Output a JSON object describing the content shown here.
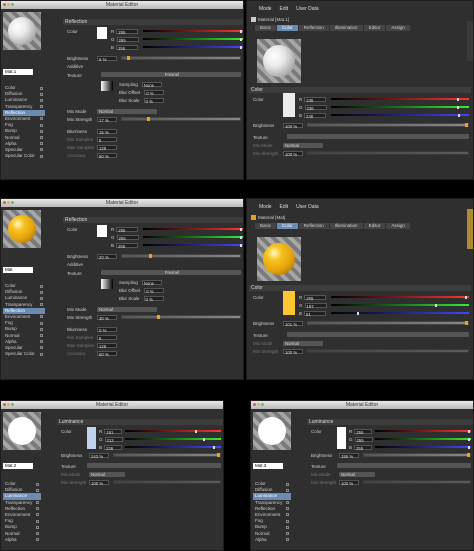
{
  "editor": {
    "title": "Material Editor",
    "mat1": "Mat.1",
    "mat": "Mat",
    "mat2": "Mat.2",
    "mat3": "Mat.3"
  },
  "channels_a": [
    "Color",
    "Diffusion",
    "Luminance",
    "Transparency",
    "Reflection",
    "Environment",
    "Fog",
    "Bump",
    "Normal",
    "Alpha",
    "Specular",
    "Specular Color"
  ],
  "channels_b": [
    "Color",
    "Diffusion",
    "Luminance",
    "Transparency",
    "Reflection",
    "Environment",
    "Fog",
    "Bump",
    "Normal",
    "Alpha",
    "Specular",
    "Specular Color"
  ],
  "channels_c": [
    "Color",
    "Diffusion",
    "Luminance",
    "Transparency",
    "Reflection",
    "Environment",
    "Fog",
    "Bump",
    "Normal",
    "Alpha"
  ],
  "reflection": {
    "header": "Reflection",
    "color": "Color",
    "r": "R",
    "g": "G",
    "b": "B",
    "v255": "255",
    "brightness_label": "Brightness",
    "brightness1": "6 %",
    "brightness2": "20 %",
    "additive": "Additive",
    "texture": "Texture",
    "fresnel": "Fresnel",
    "sampling": "Sampling",
    "sampling_val": "None",
    "blur_offset": "Blur Offset",
    "blur_scale": "Blur Scale",
    "zero": "0 %",
    "mix_mode": "Mix Mode",
    "normal": "Normal",
    "mix_strength": "Mix Strength",
    "ms1": "17 %",
    "ms2": "30 %",
    "blurriness": "Blurriness",
    "bl1": "15 %",
    "bl2": "0 %",
    "min_samples": "Min Samples",
    "min_val": "5",
    "max_samples": "Max Samples",
    "max_val": "128",
    "accuracy": "Accuracy",
    "acc_val": "50 %"
  },
  "attr": {
    "menu": [
      "Mode",
      "Edit",
      "User Data"
    ],
    "mat1": "Material [Mat.1]",
    "mat": "Material [Mat]",
    "tabs": [
      "Basic",
      "Color",
      "Reflection",
      "Illumination",
      "Editor",
      "Assign"
    ],
    "color_head": "Color",
    "color": "Color",
    "r": "R",
    "g": "G",
    "b": "B",
    "w1": "236",
    "w2": "236",
    "w3": "238",
    "gr": "255",
    "gg": "197",
    "gb": "51",
    "brightness": "Brightness",
    "b1": "100 %",
    "b2": "101 %",
    "texture": "Texture",
    "mix_mode": "Mix Mode",
    "normal": "Normal",
    "mix_strength": "Mix Strength",
    "ms": "100 %"
  },
  "lum": {
    "header": "Luminance",
    "color": "Color",
    "r": "R",
    "g": "G",
    "b": "B",
    "r1": "191",
    "g1": "212",
    "b1": "236",
    "r2": "255",
    "g2": "255",
    "b2": "255",
    "brightness": "Brightness",
    "br1": "243 %",
    "br2": "195 %",
    "texture": "Texture",
    "mix_mode": "Mix Mode",
    "normal": "Normal",
    "mix_strength": "Mix Strength",
    "ms": "100 %"
  }
}
